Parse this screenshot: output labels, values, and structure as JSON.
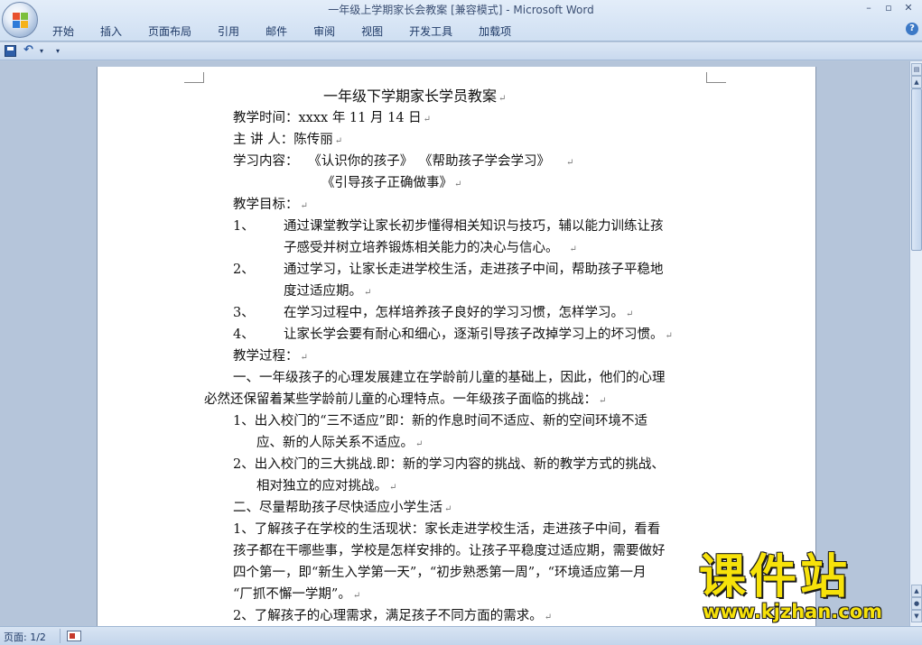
{
  "window": {
    "title": "一年级上学期家长会教案 [兼容模式] - Microsoft Word",
    "controls": [
      "–",
      "▫",
      "✕"
    ]
  },
  "ribbon": {
    "tabs": [
      "开始",
      "插入",
      "页面布局",
      "引用",
      "邮件",
      "审阅",
      "视图",
      "开发工具",
      "加载项"
    ],
    "help_label": "?"
  },
  "quick_access": {
    "icons": [
      "save-icon",
      "undo-icon",
      "dropdown-icon",
      "customize-icon"
    ],
    "undo_glyph": "↶",
    "dropdown_glyph": "▾",
    "more_glyph": "▾"
  },
  "document": {
    "title": "一年级下学期家长学员教案",
    "time": "教学时间：xxxx 年 11 月 14 日",
    "speaker": "主 讲 人：陈传丽",
    "content_label": "学习内容：",
    "content_1": "《认识你的孩子》",
    "content_2": "《帮助孩子学会学习》",
    "content_3": "《引导孩子正确做事》",
    "goals_heading": "教学目标：",
    "goals": [
      {
        "num": "1、",
        "l1": "通过课堂教学让家长初步懂得相关知识与技巧，辅以能力训练让孩",
        "l2": "子感受并树立培养锻炼相关能力的决心与信心。"
      },
      {
        "num": "2、",
        "l1": "通过学习，让家长走进学校生活，走进孩子中间，帮助孩子平稳地",
        "l2": "度过适应期。"
      },
      {
        "num": "3、",
        "l1": "在学习过程中，怎样培养孩子良好的学习习惯，怎样学习。",
        "l2": ""
      },
      {
        "num": "4、",
        "l1": "让家长学会要有耐心和细心，逐渐引导孩子改掉学习上的坏习惯。",
        "l2": ""
      }
    ],
    "process_heading": "教学过程：",
    "p1_l1": "一、一年级孩子的心理发展建立在学龄前儿童的基础上，因此，他们的心理",
    "p1_l2": "必然还保留着某些学龄前儿童的心理特点。一年级孩子面临的挑战：",
    "item1_l1": "1、出入校门的“三不适应”即：新的作息时间不适应、新的空间环境不适",
    "item1_l2": "应、新的人际关系不适应。",
    "item2_l1": "2、出入校门的三大挑战.即：新的学习内容的挑战、新的教学方式的挑战、",
    "item2_l2": "相对独立的应对挑战。",
    "sec2": "二、尽量帮助孩子尽快适应小学生活",
    "s2_1_l1": "1、了解孩子在学校的生活现状：家长走进学校生活，走进孩子中间，看看",
    "s2_1_l2": "孩子都在干哪些事，学校是怎样安排的。让孩子平稳度过适应期，需要做好",
    "s2_1_l3": "四个第一，即“新生入学第一天”，“初步熟悉第一周”，“环境适应第一月",
    "s2_1_l4": "“厂抓不懈一学期”。",
    "s2_2": "2、了解孩子的心理需求，满足孩子不同方面的需求。",
    "para_mark": "↵"
  },
  "status_bar": {
    "page": "页面: 1/2"
  },
  "watermark": {
    "title": "课件站",
    "url": "www.kjzhan.com"
  },
  "colors": {
    "ribbon_bg": "#d6e4f5",
    "workspace_bg": "#b5c5da",
    "watermark": "#f7e20a"
  }
}
